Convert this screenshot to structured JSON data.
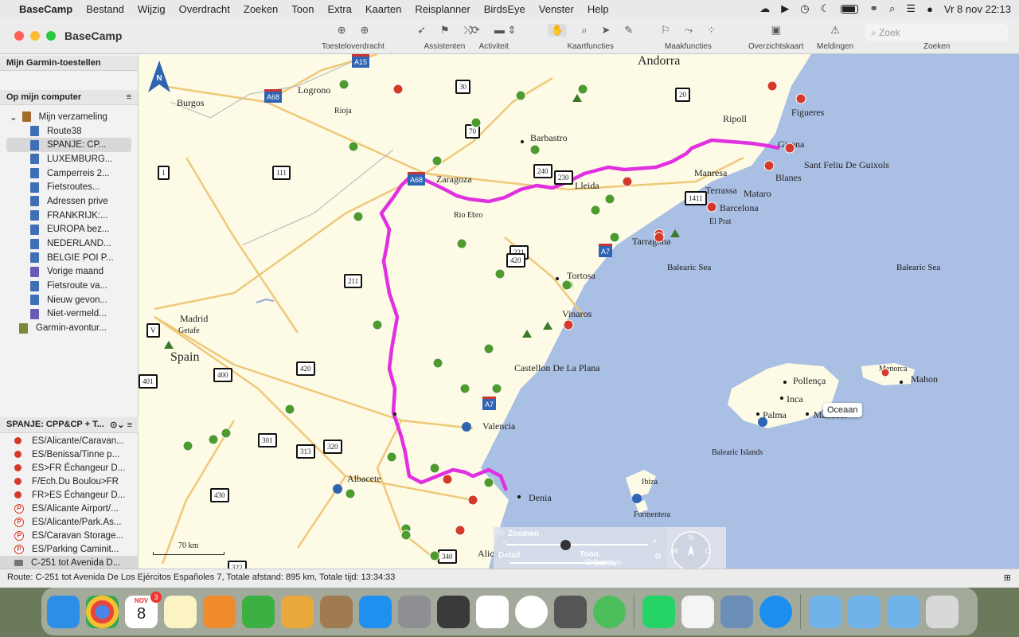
{
  "menubar": {
    "app_name": "BaseCamp",
    "items": [
      "Bestand",
      "Wijzig",
      "Overdracht",
      "Zoeken",
      "Toon",
      "Extra",
      "Kaarten",
      "Reisplanner",
      "BirdsEye",
      "Venster",
      "Help"
    ],
    "clock": "Vr 8 nov  22:13"
  },
  "window": {
    "title": "BaseCamp",
    "toolbar_groups": [
      "Toesteloverdracht",
      "Assistenten",
      "Activiteit",
      "Kaartfuncties",
      "Maakfuncties",
      "Overzichtskaart",
      "Meldingen",
      "Zoeken"
    ],
    "search_placeholder": "Zoek"
  },
  "sidebar": {
    "garmin_header": "Mijn Garmin-toestellen",
    "computer_header": "Op mijn computer",
    "collection": "Mijn verzameling",
    "items": [
      "Route38",
      "SPANJE: CP...",
      "LUXEMBURG...",
      "Camperreis 2...",
      "Fietsroutes...",
      "Adressen prive",
      "FRANKRIJK:...",
      "EUROPA bez...",
      "NEDERLAND...",
      "BELGIE POI P...",
      "Vorige maand",
      "Fietsroute va...",
      "Nieuw gevon...",
      "Niet-vermeld..."
    ],
    "adventure": "Garmin-avontur...",
    "list_header": "SPANJE: CPP&CP + T...",
    "waypoints": [
      "ES/Alicante/Caravan...",
      "ES/Benissa/Tinne p...",
      "ES>FR Échangeur D...",
      "F/Ech.Du Boulou>FR",
      "FR>ES Échangeur D...",
      "ES/Alicante Airport/...",
      "ES/Alicante/Park.As...",
      "ES/Caravan Storage...",
      "ES/Parking Caminit...",
      "C-251 tot Avenida D..."
    ]
  },
  "map": {
    "country": "Spain",
    "andorra": "Andorra",
    "cities": [
      "Burgos",
      "Logrono",
      "Rioja",
      "Zaragoza",
      "Rio Ebro",
      "Barbastro",
      "Lleida",
      "Ripoll",
      "Figueres",
      "Girona",
      "Sant Feliu De Guixols",
      "Manresa",
      "Terrassa",
      "Blanes",
      "Mataro",
      "Barcelona",
      "El Prat",
      "Tarragona",
      "Tortosa",
      "Vinaros",
      "Castellon De La Plana",
      "Valencia",
      "Madrid",
      "Getafe",
      "Albacete",
      "Denia",
      "Alicante",
      "Pollença",
      "Inca",
      "Palma",
      "Manacor",
      "Menorca",
      "Mahon",
      "Ibiza",
      "Formentera",
      "Balearic Islands"
    ],
    "seas": [
      "Balearic Sea",
      "Balearic Sea"
    ],
    "roads": [
      "A15",
      "A68",
      "30",
      "20",
      "1",
      "111",
      "70",
      "240",
      "230",
      "A68",
      "1411",
      "A7",
      "221",
      "420",
      "211",
      "V",
      "400",
      "420",
      "401",
      "301",
      "313",
      "320",
      "430",
      "322",
      "A7",
      "340"
    ],
    "tooltip": "Oceaan",
    "scale": "70 km",
    "zoom_label": "Zoomen",
    "detail_label": "Detail",
    "show_label": "Toon:",
    "check_labels": "Labels",
    "check_overlays": "Overlays",
    "compass": {
      "n": "N",
      "s": "Z",
      "w": "W",
      "e": "O"
    }
  },
  "status": "Route: C-251 tot Avenida De Los Ejércitos Españoles 7, Totale afstand: 895 km, Totale tijd: 13:34:33",
  "dock": {
    "calendar_month": "NOV",
    "calendar_day": "8",
    "calendar_badge": "3"
  },
  "colors": {
    "route": "#e030e0",
    "sea": "#a9bfe3",
    "land": "#fdfbe6",
    "poi_green": "#4f9a2d",
    "poi_red": "#d43a2a"
  }
}
